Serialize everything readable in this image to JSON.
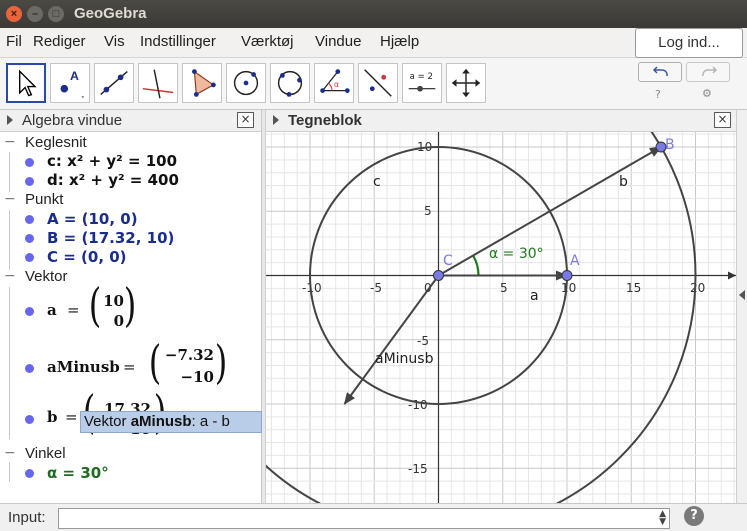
{
  "window": {
    "title": "GeoGebra"
  },
  "menu": {
    "items": [
      "Fil",
      "Rediger",
      "Vis",
      "Indstillinger",
      "Værktøj",
      "Vindue",
      "Hjælp"
    ],
    "login": "Log ind..."
  },
  "toolbar": {
    "tools": [
      "move-tool",
      "point-tool",
      "line-tool",
      "perpendicular-tool",
      "polygon-tool",
      "circle-center-point-tool",
      "circle-three-points-tool",
      "angle-tool",
      "reflect-tool",
      "slider-tool",
      "move-graphics-tool"
    ],
    "slider_label": "a = 2",
    "point_label": "A",
    "angle_label": "α"
  },
  "algebra": {
    "title": "Algebra vindue",
    "categories": {
      "conics": "Keglesnit",
      "points": "Punkt",
      "vectors": "Vektor",
      "angles": "Vinkel"
    },
    "conics": [
      "c: x² + y² = 100",
      "d: x² + y² = 400"
    ],
    "points": [
      "A = (10, 0)",
      "B = (17.32, 10)",
      "C = (0, 0)"
    ],
    "vectors": [
      {
        "name": "a",
        "top": "10",
        "bottom": "0"
      },
      {
        "name": "aMinusb",
        "top": "−7.32",
        "bottom": "−10"
      },
      {
        "name": "b",
        "top": "17.32",
        "bottom": "10"
      }
    ],
    "eq": "=",
    "angles": [
      "α = 30°"
    ],
    "tooltip": {
      "prefix": "Vektor",
      "name": "aMinusb",
      "suffix": ": a - b"
    }
  },
  "graphics": {
    "title": "Tegneblok",
    "x_ticks": [
      "-10",
      "-5",
      "0",
      "5",
      "10",
      "15",
      "20"
    ],
    "y_ticks": [
      "10",
      "5",
      "-5",
      "-10",
      "-15"
    ],
    "labels": {
      "A": "A",
      "B": "B",
      "C": "C",
      "circle_c": "c",
      "vector_a": "a",
      "vector_b": "b",
      "vector_aMinusb": "aMinusb",
      "angle": "α = 30°"
    },
    "colors": {
      "point": "#6666ee",
      "angle": "#1f7a1f",
      "vector": "#444444"
    }
  },
  "input": {
    "label": "Input:",
    "value": ""
  }
}
